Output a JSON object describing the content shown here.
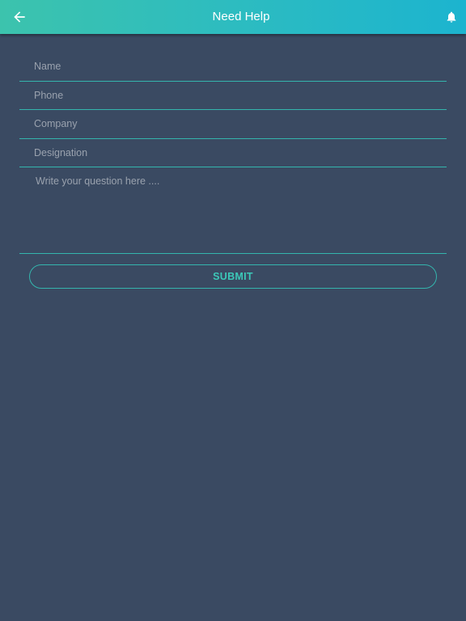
{
  "appbar": {
    "title": "Need Help",
    "back_icon": "arrow-left-icon",
    "notification_icon": "bell-icon"
  },
  "form": {
    "name": {
      "placeholder": "Name",
      "value": ""
    },
    "phone": {
      "placeholder": "Phone",
      "value": ""
    },
    "company": {
      "placeholder": "Company",
      "value": ""
    },
    "designation": {
      "placeholder": "Designation",
      "value": ""
    },
    "question": {
      "placeholder": "Write your question here ....",
      "value": ""
    },
    "submit_label": "SUBMIT"
  },
  "colors": {
    "background": "#3a4a62",
    "appbar_start": "#3cc3ad",
    "appbar_end": "#1cb4cf",
    "accent": "#34b5ad",
    "placeholder": "#9aa2ae"
  }
}
